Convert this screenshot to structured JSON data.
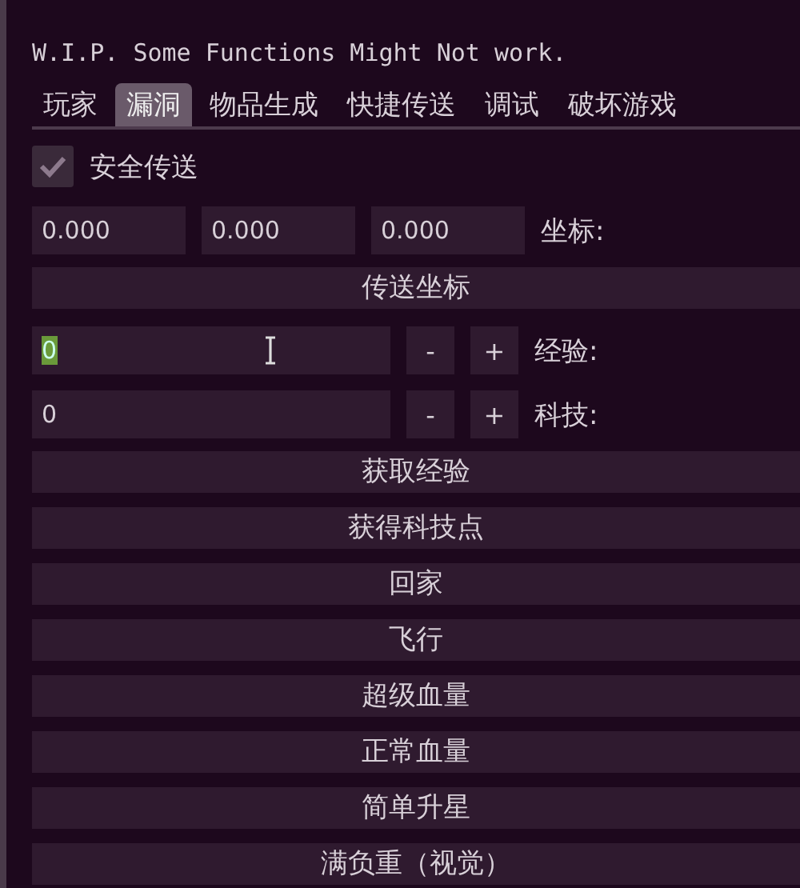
{
  "notice": "W.I.P. Some Functions Might Not work.",
  "tabs": [
    {
      "label": "玩家",
      "selected": false
    },
    {
      "label": "漏洞",
      "selected": true
    },
    {
      "label": "物品生成",
      "selected": false
    },
    {
      "label": "快捷传送",
      "selected": false
    },
    {
      "label": "调试",
      "selected": false
    },
    {
      "label": "破坏游戏",
      "selected": false
    }
  ],
  "safe_teleport": {
    "label": "安全传送",
    "checked": true
  },
  "coordinates": {
    "values": [
      "0.000",
      "0.000",
      "0.000"
    ],
    "label": "坐标:"
  },
  "teleport_button": "传送坐标",
  "steppers": [
    {
      "value": "0",
      "focused": true,
      "minus": "-",
      "plus": "+",
      "label": "经验:"
    },
    {
      "value": "0",
      "focused": false,
      "minus": "-",
      "plus": "+",
      "label": "科技:"
    }
  ],
  "buttons": [
    "获取经验",
    "获得科技点",
    "回家",
    "飞行",
    "超级血量",
    "正常血量",
    "简单升星",
    "满负重（视觉）"
  ]
}
